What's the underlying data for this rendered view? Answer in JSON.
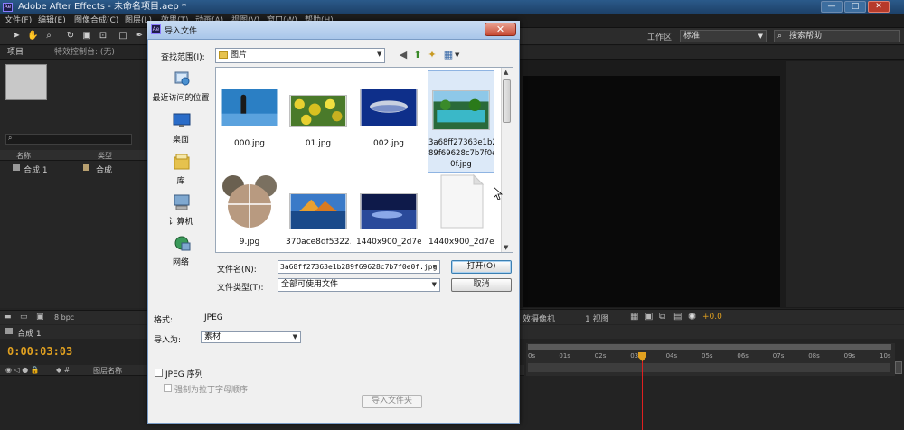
{
  "window": {
    "title": "Adobe After Effects - 未命名项目.aep *",
    "app_icon": "Ae",
    "controls": [
      "—",
      "□",
      "✕"
    ]
  },
  "menubar": [
    "文件(F)",
    "编辑(E)",
    "图像合成(C)",
    "图层(L)",
    "效果(T)",
    "动画(A)",
    "视图(V)",
    "窗口(W)",
    "帮助(H)"
  ],
  "toolbar": {
    "workspace_label": "工作区:",
    "workspace_value": "标准",
    "search_help": "搜索帮助"
  },
  "project_panel": {
    "tab_project": "项目",
    "tab_effects": "特效控制台: (无)",
    "col_name": "名称",
    "col_type": "类型",
    "row_name": "合成 1",
    "row_type": "合成",
    "bpc": "8 bpc"
  },
  "viewer": {
    "camera": "效摄像机",
    "views": "1 视图",
    "exposure": "+0.0"
  },
  "timeline": {
    "tab": "合成 1",
    "timecode": "0:00:03:03",
    "layer_col": "图层名称",
    "ticks": [
      "0s",
      "01s",
      "02s",
      "03s",
      "04s",
      "05s",
      "06s",
      "07s",
      "08s",
      "09s",
      "10s"
    ]
  },
  "dialog": {
    "title": "导入文件",
    "close": "✕",
    "look_in_label": "查找范围(I):",
    "look_in_value": "图片",
    "places": [
      "最近访问的位置",
      "桌面",
      "库",
      "计算机",
      "网络"
    ],
    "files": [
      {
        "name": "000.jpg"
      },
      {
        "name": "01.jpg"
      },
      {
        "name": "002.jpg"
      },
      {
        "name_lines": [
          "3a68ff27363e1b2",
          "89f69628c7b7f0e",
          "0f.jpg"
        ]
      },
      {
        "name": "9.jpg"
      },
      {
        "name": "370ace8df5322..."
      },
      {
        "name": "1440x900_2d7e..."
      },
      {
        "name": "1440x900_2d7e..."
      }
    ],
    "filename_label": "文件名(N):",
    "filename_value": "3a68ff27363e1b289f69628c7b7f0e0f.jpg",
    "filetype_label": "文件类型(T):",
    "filetype_value": "全部可使用文件",
    "open_label": "打开(O)",
    "cancel_label": "取消",
    "format_label": "格式:",
    "format_value": "JPEG",
    "import_as_label": "导入为:",
    "import_as_value": "素材",
    "sequence_label": "JPEG 序列",
    "alpha_order_label": "强制为拉丁字母顺序",
    "import_folder_label": "导入文件夹"
  }
}
